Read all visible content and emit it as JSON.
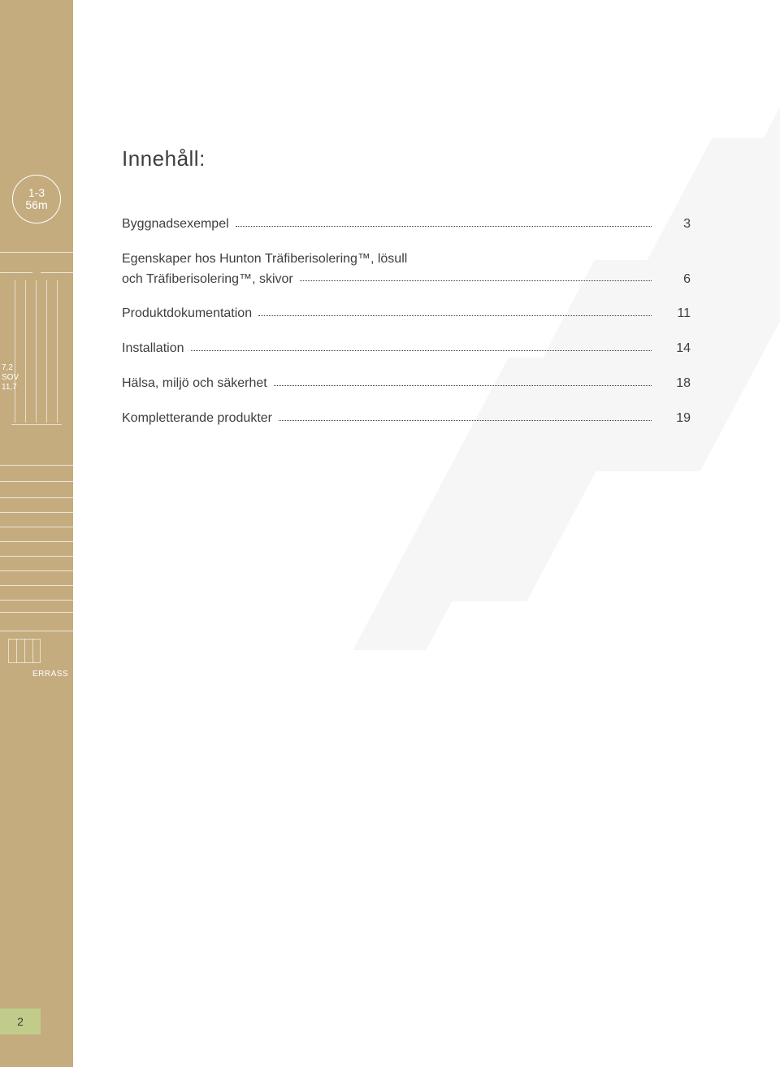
{
  "sidebar": {
    "circle_line1": "1-3",
    "circle_line2": "56m",
    "small1": "7,2",
    "small2": "SOV",
    "small3": "11,7",
    "terrass": "ERRASS"
  },
  "title": "Innehåll:",
  "toc": {
    "item1": {
      "label": "Byggnadsexempel",
      "page": "3"
    },
    "item2": {
      "label1": "Egenskaper hos Hunton Träfiberisolering™, lösull",
      "label2": "och Träfiberisolering™, skivor",
      "page": "6"
    },
    "item3": {
      "label": "Produktdokumentation",
      "page": "11"
    },
    "item4": {
      "label": "Installation",
      "page": "14"
    },
    "item5": {
      "label": "Hälsa, miljö och säkerhet",
      "page": "18"
    },
    "item6": {
      "label": "Kompletterande produkter",
      "page": "19"
    }
  },
  "page_number": "2"
}
